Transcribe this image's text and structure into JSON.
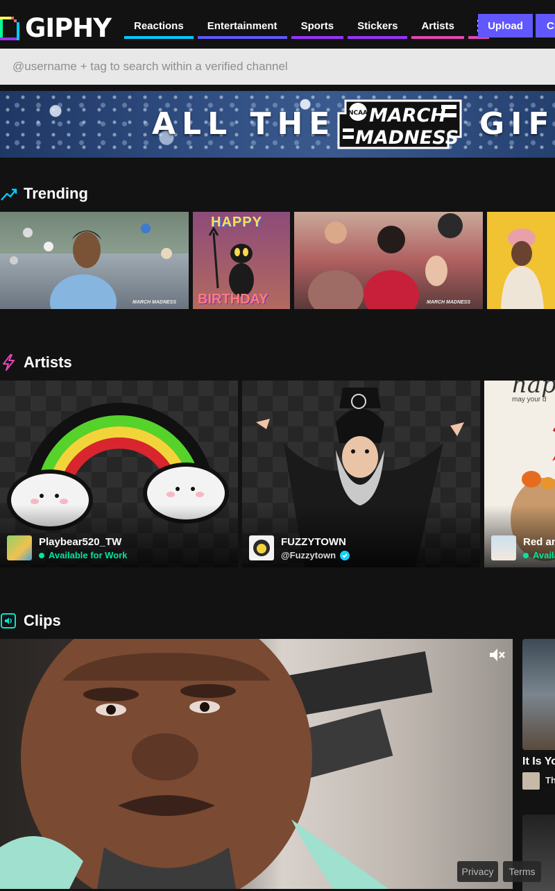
{
  "brand": {
    "name": "GIPHY"
  },
  "nav": {
    "items": [
      {
        "label": "Reactions"
      },
      {
        "label": "Entertainment"
      },
      {
        "label": "Sports"
      },
      {
        "label": "Stickers"
      },
      {
        "label": "Artists"
      }
    ],
    "more_icon": "vertical-dots-icon",
    "upload_label": "Upload",
    "create_label": "Cr"
  },
  "search": {
    "placeholder": "@username + tag to search within a verified channel",
    "value": ""
  },
  "banner": {
    "left_text": "ALL THE",
    "logo_text_top": "MARCH",
    "logo_text_bottom": "MADNESS",
    "logo_badge": "NCAA",
    "right_text": "GIFS"
  },
  "sections": {
    "trending": {
      "title": "Trending",
      "icon": "trending-icon",
      "icon_color": "#00ccff"
    },
    "artists": {
      "title": "Artists",
      "icon": "lightning-icon",
      "icon_color": "#e646b6"
    },
    "clips": {
      "title": "Clips",
      "icon": "speaker-icon",
      "icon_color": "#00e6cc"
    }
  },
  "trending_tiles": [
    {
      "overlay": "MARCH MADNESS"
    },
    {
      "line1": "HAPPY",
      "line2": "BIRTHDAY"
    },
    {
      "overlay": "MARCH MADNESS"
    },
    {}
  ],
  "artists": [
    {
      "name": "Playbear520_TW",
      "status": "Available for Work"
    },
    {
      "name": "FUZZYTOWN",
      "handle": "@Fuzzytown"
    },
    {
      "name": "Red an",
      "status": "Availa",
      "card_text_top": "happy",
      "card_text_sub": "may your d"
    }
  ],
  "clips": {
    "side_title": "It Is Yo",
    "side_user": "Th"
  },
  "footer": {
    "privacy": "Privacy",
    "terms": "Terms"
  },
  "colors": {
    "accent": "#6157ff",
    "background": "#121212",
    "available": "#00e6a0"
  }
}
